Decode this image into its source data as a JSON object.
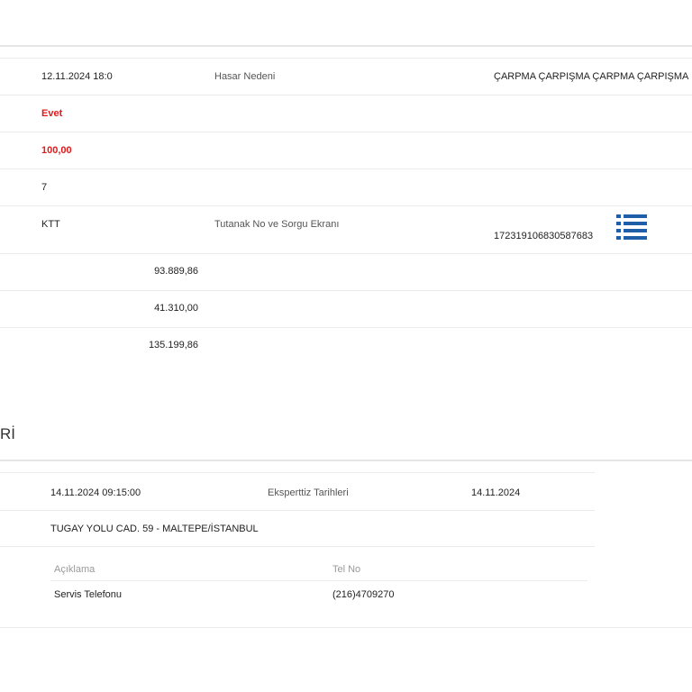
{
  "claim": {
    "date_value": "12.11.2024 18:0",
    "damage_reason_label": "Hasar Nedeni",
    "damage_reason_value": "ÇARPMA ÇARPIŞMA ÇARPMA ÇARPIŞMA",
    "flag_value": "Evet",
    "percent_value": "100,00",
    "count_value": "7",
    "type_value": "KTT",
    "report_label": "Tutanak No ve Sorgu Ekranı",
    "report_number": "172319106830587683",
    "amount_1": "93.889,86",
    "amount_2": "41.310,00",
    "amount_3": "135.199,86"
  },
  "section2": {
    "title_fragment": "Rİ",
    "appointment_value": "14.11.2024 09:15:00",
    "expert_dates_label": "Eksperttiz Tarihleri",
    "expert_dates_value": "14.11.2024",
    "address_value": "TUGAY YOLU CAD. 59 - MALTEPE/İSTANBUL",
    "contacts": {
      "headers": [
        "Açıklama",
        "Tel No"
      ],
      "rows": [
        {
          "description": "Servis Telefonu",
          "phone": "(216)4709270"
        }
      ]
    }
  },
  "icons": {
    "report_list": "list-icon"
  },
  "colors": {
    "accent_red": "#e0191b",
    "icon_blue": "#1f5fa8"
  }
}
